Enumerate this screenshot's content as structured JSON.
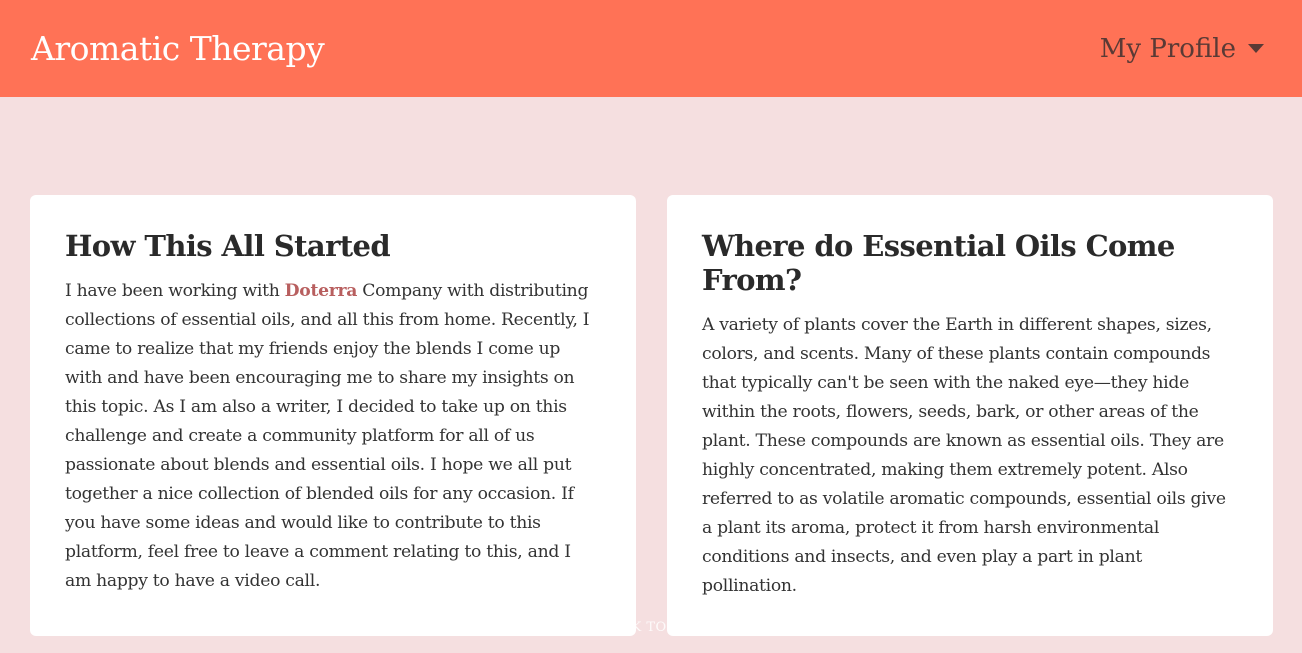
{
  "header": {
    "brand": "Aromatic Therapy",
    "profile_label": "My Profile"
  },
  "cards": [
    {
      "title": "How This All Started",
      "text_before": "I have been working with ",
      "link": "Doterra",
      "text_after": " Company with distributing collections of essential oils, and all this from home. Recently, I came to realize that my friends enjoy the blends I come up with and have been encouraging me to share my insights on this topic. As I am also a writer, I decided to take up on this challenge and create a community platform for all of us passionate about blends and essential oils. I hope we all put together a nice collection of blended oils for any occasion. If you have some ideas and would like to contribute to this platform, feel free to leave a comment relating to this, and I am happy to have a video call."
    },
    {
      "title": "Where do Essential Oils Come From?",
      "text": "A variety of plants cover the Earth in different shapes, sizes, colors, and scents. Many of these plants contain compounds that typically can't be seen with the naked eye—they hide within the roots, flowers, seeds, bark, or other areas of the plant. These compounds are known as essential oils. They are highly concentrated, making them extremely potent. Also referred to as volatile aromatic compounds, essential oils give a plant its aroma, protect it from harsh environmental conditions and insects, and even play a part in plant pollination."
    }
  ],
  "footer": {
    "note": "BACK TO TOP"
  },
  "colors": {
    "navbar": "#ff7256",
    "background": "#f5dfe0",
    "link": "#b85f5f"
  }
}
